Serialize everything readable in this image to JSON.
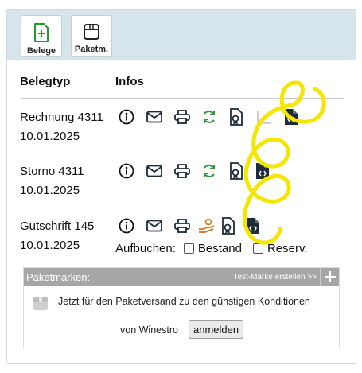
{
  "toolbar": {
    "belege_label": "Belege",
    "paketm_label": "Paketm."
  },
  "table": {
    "col_belegtyp": "Belegtyp",
    "col_infos": "Infos"
  },
  "rows": [
    {
      "type": "Rechnung 4311",
      "date": "10.01.2025"
    },
    {
      "type": "Storno 4311",
      "date": "10.01.2025"
    },
    {
      "type": "Gutschrift 145",
      "date": "10.01.2025"
    }
  ],
  "aufbuchen": {
    "label": "Aufbuchen:",
    "bestand": "Bestand",
    "reserv": "Reserv."
  },
  "paketmarken": {
    "title": "Paketmarken:",
    "test_link": "Test-Marke erstellen >>",
    "promo": "Jetzt für den Paketversand zu den günstigen Konditionen",
    "von": "von Winestro",
    "login_button": "anmelden"
  },
  "colors": {
    "toolbar_bg": "#d6e4ec",
    "icon_dark": "#1d2b3a",
    "icon_green": "#2e9a3a",
    "icon_orange": "#d2741a",
    "highlight_yellow": "#f5e600"
  }
}
